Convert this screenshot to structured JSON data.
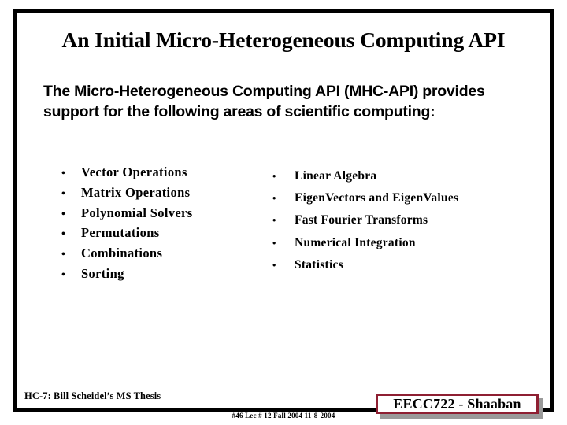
{
  "slide": {
    "title": "An Initial Micro-Heterogeneous Computing API",
    "intro": "The Micro-Heterogeneous Computing API (MHC-API) provides support for the following areas of scientific computing:",
    "bullet_marker": "•",
    "columns": {
      "left": [
        "Vector Operations",
        "Matrix Operations",
        "Polynomial Solvers",
        "Permutations",
        "Combinations",
        "Sorting"
      ],
      "right": [
        "Linear Algebra",
        "EigenVectors and EigenValues",
        "Fast Fourier Transforms",
        "Numerical Integration",
        "Statistics"
      ]
    },
    "footer": {
      "note": "HC-7: Bill Scheidel’s MS Thesis",
      "meta": "#46   Lec # 12   Fall 2004  11-8-2004",
      "badge": "EECC722 - Shaaban"
    },
    "colors": {
      "frame": "#000000",
      "text": "#000000",
      "badge_border": "#8e1f32",
      "badge_shadow": "#9a9a9a",
      "background": "#ffffff"
    }
  }
}
